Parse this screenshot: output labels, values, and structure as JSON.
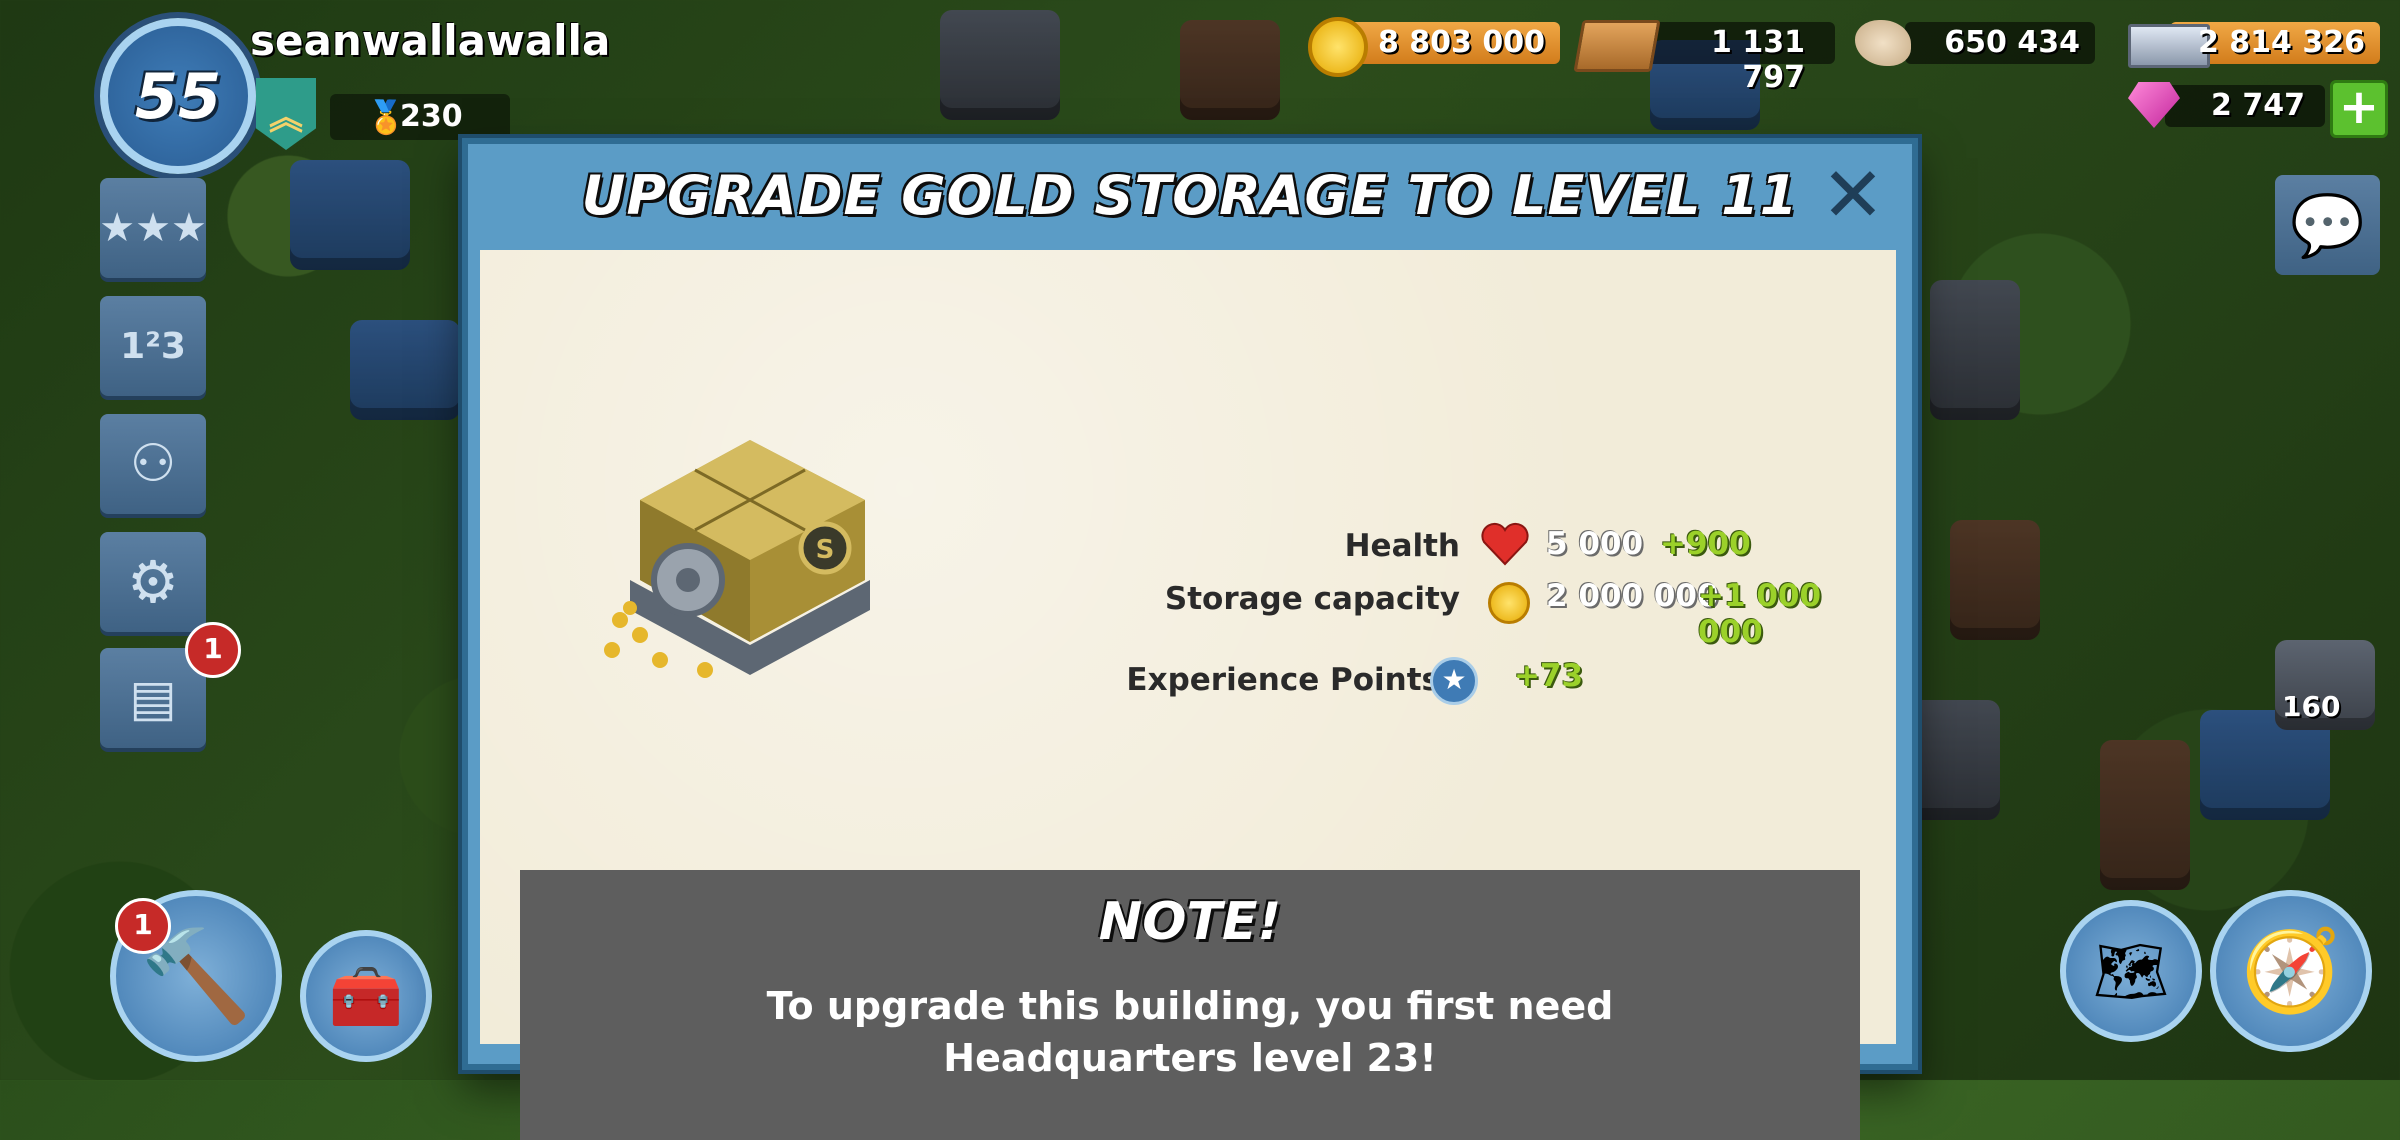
{
  "player": {
    "level": "55",
    "name": "seanwallawalla",
    "medals": "230"
  },
  "resources": {
    "gold": "8 803 000",
    "wood": "1 131 797",
    "stone": "650 434",
    "iron": "2 814 326",
    "diamonds": "2 747"
  },
  "left_menu": {
    "news_badge": "1",
    "builder_badge": "1"
  },
  "right_panel": {
    "gem_count": "160"
  },
  "modal": {
    "title": "UPGRADE GOLD STORAGE TO LEVEL 11",
    "stats": [
      {
        "label": "Health",
        "value": "5 000",
        "bonus": "+900",
        "icon": "heart-icon"
      },
      {
        "label": "Storage capacity",
        "value": "2 000 000",
        "bonus": "+1 000 000",
        "icon": "coin-icon"
      },
      {
        "label": "Experience Points",
        "value": "",
        "bonus": "+73",
        "icon": "xp-star-icon"
      }
    ],
    "note_title": "NOTE!",
    "note_text_line1": "To upgrade this building, you first need",
    "note_text_line2": "Headquarters level 23!"
  },
  "colors": {
    "modal_frame": "#5b9cc6",
    "paper": "#f2ecd9",
    "bonus_green": "#9bd12a",
    "note_bg": "#5e5e5e"
  }
}
